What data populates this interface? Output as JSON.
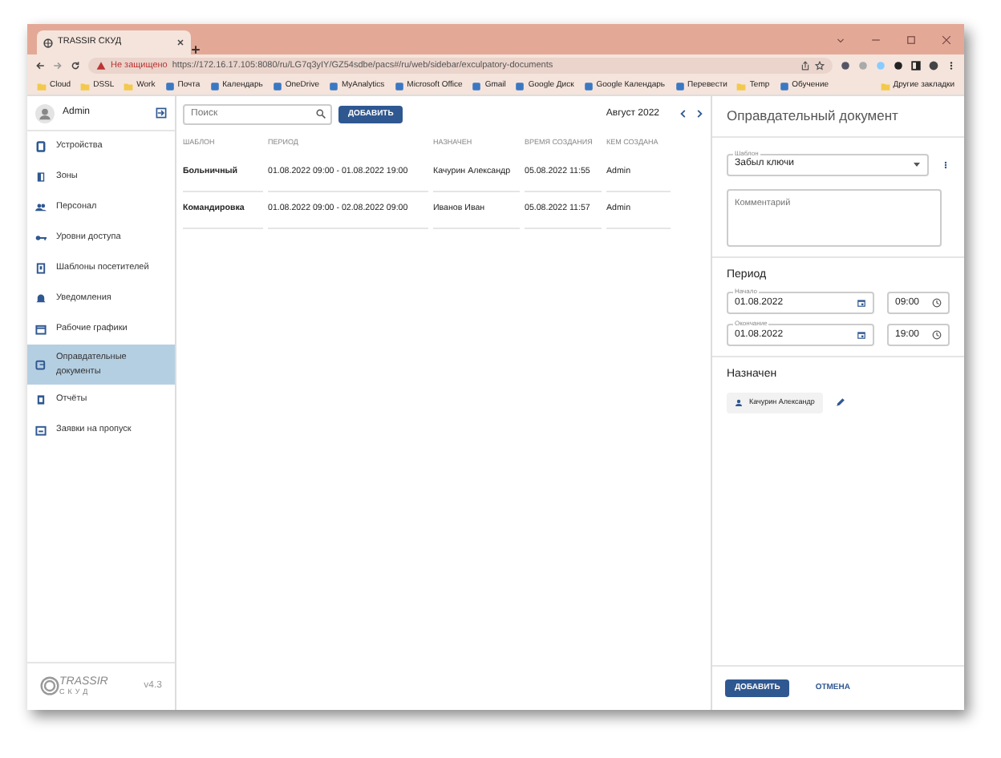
{
  "browser": {
    "tab_title": "TRASSIR СКУД",
    "security_warning": "Не защищено",
    "url": "https://172.16.17.105:8080/ru/LG7q3yIY/GZ54sdbe/pacs#/ru/web/sidebar/exculpatory-documents",
    "bookmarks": [
      {
        "label": "Cloud",
        "kind": "folder"
      },
      {
        "label": "DSSL",
        "kind": "folder"
      },
      {
        "label": "Work",
        "kind": "folder"
      },
      {
        "label": "Почта",
        "kind": "link"
      },
      {
        "label": "Календарь",
        "kind": "link"
      },
      {
        "label": "OneDrive",
        "kind": "link"
      },
      {
        "label": "MyAnalytics",
        "kind": "link"
      },
      {
        "label": "Microsoft Office",
        "kind": "link"
      },
      {
        "label": "Gmail",
        "kind": "link"
      },
      {
        "label": "Google Диск",
        "kind": "link"
      },
      {
        "label": "Google Календарь",
        "kind": "link"
      },
      {
        "label": "Перевести",
        "kind": "link"
      },
      {
        "label": "Temp",
        "kind": "folder"
      },
      {
        "label": "Обучение",
        "kind": "link"
      }
    ],
    "other_bookmarks": "Другие закладки"
  },
  "sidebar": {
    "user": "Admin",
    "items": [
      {
        "label": "Устройства",
        "selected": false
      },
      {
        "label": "Зоны",
        "selected": false
      },
      {
        "label": "Персонал",
        "selected": false
      },
      {
        "label": "Уровни доступа",
        "selected": false
      },
      {
        "label": "Шаблоны посетителей",
        "selected": false
      },
      {
        "label": "Уведомления",
        "selected": false
      },
      {
        "label": "Рабочие графики",
        "selected": false
      },
      {
        "label": "Оправдательные документы",
        "selected": true
      },
      {
        "label": "Отчёты",
        "selected": false
      },
      {
        "label": "Заявки на пропуск",
        "selected": false
      }
    ],
    "logo_text": "TRASSIR",
    "logo_subtext": "СКУД",
    "version": "v4.3"
  },
  "list": {
    "search_placeholder": "Поиск",
    "add_button": "ДОБАВИТЬ",
    "month": "Август 2022",
    "columns": [
      "ШАБЛОН",
      "ПЕРИОД",
      "НАЗНАЧЕН",
      "ВРЕМЯ СОЗДАНИЯ",
      "КЕМ СОЗДАНА"
    ],
    "rows": [
      [
        "Больничный",
        "01.08.2022 09:00 - 01.08.2022 19:00",
        "Качурин Александр",
        "05.08.2022 11:55",
        "Admin"
      ],
      [
        "Командировка",
        "01.08.2022 09:00 - 02.08.2022 09:00",
        "Иванов Иван",
        "05.08.2022 11:57",
        "Admin"
      ]
    ]
  },
  "panel": {
    "title": "Оправдательный документ",
    "template_label": "Шаблон",
    "template_value": "Забыл ключи",
    "comment_placeholder": "Комментарий",
    "period_heading": "Период",
    "start_label": "Начало",
    "start_date": "01.08.2022",
    "start_time": "09:00",
    "end_label": "Окончание",
    "end_date": "01.08.2022",
    "end_time": "19:00",
    "assigned_heading": "Назначен",
    "assignee": "Качурин Александр",
    "add_button": "ДОБАВИТЬ",
    "cancel_button": "ОТМЕНА"
  }
}
